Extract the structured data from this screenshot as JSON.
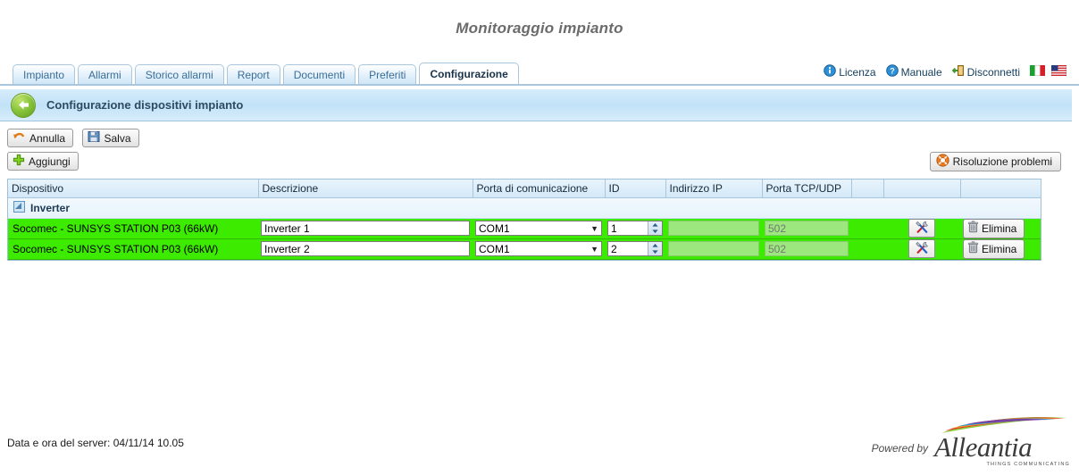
{
  "page": {
    "title": "Monitoraggio impianto"
  },
  "tabs": [
    {
      "label": "Impianto",
      "active": false
    },
    {
      "label": "Allarmi",
      "active": false
    },
    {
      "label": "Storico allarmi",
      "active": false
    },
    {
      "label": "Report",
      "active": false
    },
    {
      "label": "Documenti",
      "active": false
    },
    {
      "label": "Preferiti",
      "active": false
    },
    {
      "label": "Configurazione",
      "active": true
    }
  ],
  "utility": {
    "license": "Licenza",
    "manual": "Manuale",
    "logout": "Disconnetti",
    "flag_it": "italian-flag",
    "flag_en": "us-flag"
  },
  "section": {
    "heading": "Configurazione dispositivi impianto",
    "back_icon": "back-arrow-icon"
  },
  "toolbar": {
    "cancel": "Annulla",
    "save": "Salva",
    "add": "Aggiungi",
    "troubleshoot": "Risoluzione problemi"
  },
  "table": {
    "headers": [
      "Dispositivo",
      "Descrizione",
      "Porta di comunicazione",
      "ID",
      "Indirizzo IP",
      "Porta TCP/UDP",
      "",
      "",
      ""
    ],
    "group": {
      "label": "Inverter"
    },
    "rows": [
      {
        "device": "Socomec - SUNSYS STATION P03 (66kW)",
        "description": "Inverter 1",
        "port": "COM1",
        "id": "1",
        "ip": "",
        "ip_placeholder": "",
        "tcp_port": "",
        "tcp_placeholder": "502",
        "config_icon": "tools-icon",
        "delete": "Elimina"
      },
      {
        "device": "Socomec - SUNSYS STATION P03 (66kW)",
        "description": "Inverter 2",
        "port": "COM1",
        "id": "2",
        "ip": "",
        "ip_placeholder": "",
        "tcp_port": "",
        "tcp_placeholder": "502",
        "config_icon": "tools-icon",
        "delete": "Elimina"
      }
    ]
  },
  "footer": {
    "server_time": "Data e ora del server: 04/11/14 10.05",
    "powered_by": "Powered by",
    "brand": "Alleantia",
    "brand_tagline": "THINGS COMMUNICATING"
  },
  "colors": {
    "row_green": "#3ceb00",
    "accent_blue": "#c2e2f7",
    "title_gray": "#6b6b6b"
  }
}
